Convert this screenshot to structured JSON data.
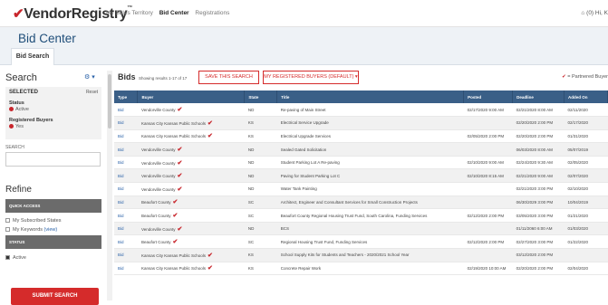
{
  "topbar": {
    "logo_prefix": "Vendor",
    "logo_suffix": "Registry",
    "nav": [
      "My Sales Territory",
      "Bid Center",
      "Registrations"
    ],
    "right": "⌂ (0)  Hi, K"
  },
  "header": {
    "title": "Bid Center",
    "tab": "Bid Search"
  },
  "sidebar": {
    "search_title": "Search",
    "gear": "⚙ ▾",
    "selected_head": "SELECTED",
    "reset": "Reset",
    "status_label": "Status",
    "status_value": "Active",
    "buyers_label": "Registered Buyers",
    "buyers_value": "Yes",
    "search_label": "SEARCH",
    "refine": "Refine",
    "quick_access": "QUICK ACCESS",
    "subscribed": "My Subscribed States",
    "keywords": "My Keywords",
    "keywords_view": "(view)",
    "status_head": "STATUS",
    "active": "Active",
    "submit": "SUBMIT SEARCH"
  },
  "main": {
    "title": "Bids",
    "showing": "Showing results 1-17 of 17",
    "save_btn": "SAVE THIS SEARCH",
    "buyers_btn": "MY REGISTERED BUYERS (DEFAULT)",
    "partnered": "= Partnered Buyer"
  },
  "table": {
    "headers": [
      "Type",
      "Buyer",
      "State",
      "Title",
      "Posted",
      "Deadline",
      "Added On"
    ],
    "rows": [
      {
        "type": "Bid",
        "buyer": "Vendorville County",
        "partner": true,
        "state": "ND",
        "title": "Re-paving of Main Street",
        "posted": "02/17/2020 9:00 AM",
        "deadline": "02/21/2020 8:00 AM",
        "added": "02/11/2020"
      },
      {
        "type": "Bid",
        "buyer": "Kansas City Kansas Public Schools",
        "partner": true,
        "state": "KS",
        "title": "Electrical Service Upgrade",
        "posted": "",
        "deadline": "02/20/2020 2:00 PM",
        "added": "02/17/2020"
      },
      {
        "type": "Bid",
        "buyer": "Kansas City Kansas Public Schools",
        "partner": true,
        "state": "KS",
        "title": "Electrical Upgrade Services",
        "posted": "02/05/2020 2:00 PM",
        "deadline": "02/20/2020 2:00 PM",
        "added": "01/31/2020"
      },
      {
        "type": "Bid",
        "buyer": "Vendorville County",
        "partner": true,
        "state": "ND",
        "title": "Sealed Gated Solicitation",
        "posted": "",
        "deadline": "06/03/2020 8:00 AM",
        "added": "05/07/2019"
      },
      {
        "type": "Bid",
        "buyer": "Vendorville County",
        "partner": true,
        "state": "ND",
        "title": "Student Parking Lot A Re-paving",
        "posted": "02/10/2020 9:00 AM",
        "deadline": "02/24/2020 9:30 AM",
        "added": "02/05/2020"
      },
      {
        "type": "Bid",
        "buyer": "Vendorville County",
        "partner": true,
        "state": "ND",
        "title": "Paving for Student Parking Lot C",
        "posted": "02/10/2020 8:15 AM",
        "deadline": "02/21/2020 9:00 AM",
        "added": "02/07/2020"
      },
      {
        "type": "Bid",
        "buyer": "Vendorville County",
        "partner": true,
        "state": "ND",
        "title": "Water Tank Painting",
        "posted": "",
        "deadline": "02/21/2020 3:00 PM",
        "added": "02/10/2020"
      },
      {
        "type": "Bid",
        "buyer": "Beaufort County",
        "partner": true,
        "state": "SC",
        "title": "Architect, Engineer and Consultant Services for Small Construction Projects",
        "posted": "",
        "deadline": "06/30/2029 3:00 PM",
        "added": "10/04/2019"
      },
      {
        "type": "Bid",
        "buyer": "Beaufort County",
        "partner": true,
        "state": "SC",
        "title": "Beaufort County Regional Housing Trust Fund, South Carolina, Funding Services",
        "posted": "02/12/2020 2:00 PM",
        "deadline": "03/05/2020 3:00 PM",
        "added": "01/21/2020"
      },
      {
        "type": "Bid",
        "buyer": "Vendorville County",
        "partner": true,
        "state": "ND",
        "title": "BCS",
        "posted": "",
        "deadline": "01/11/2060 6:00 AM",
        "added": "01/03/2020"
      },
      {
        "type": "Bid",
        "buyer": "Beaufort County",
        "partner": true,
        "state": "SC",
        "title": "Regional Housing Trust Fund, Funding Services",
        "posted": "02/12/2020 2:00 PM",
        "deadline": "02/27/2020 3:00 PM",
        "added": "01/22/2020"
      },
      {
        "type": "Bid",
        "buyer": "Kansas City Kansas Public Schools",
        "partner": true,
        "state": "KS",
        "title": "School Supply Kits for Students and Teachers - 2020/2021 School Year",
        "posted": "",
        "deadline": "03/12/2020 2:00 PM",
        "added": ""
      },
      {
        "type": "Bid",
        "buyer": "Kansas City Kansas Public Schools",
        "partner": true,
        "state": "KS",
        "title": "Concrete Repair Work",
        "posted": "02/19/2020 10:00 AM",
        "deadline": "02/20/2020 2:00 PM",
        "added": "02/04/2020"
      }
    ]
  }
}
